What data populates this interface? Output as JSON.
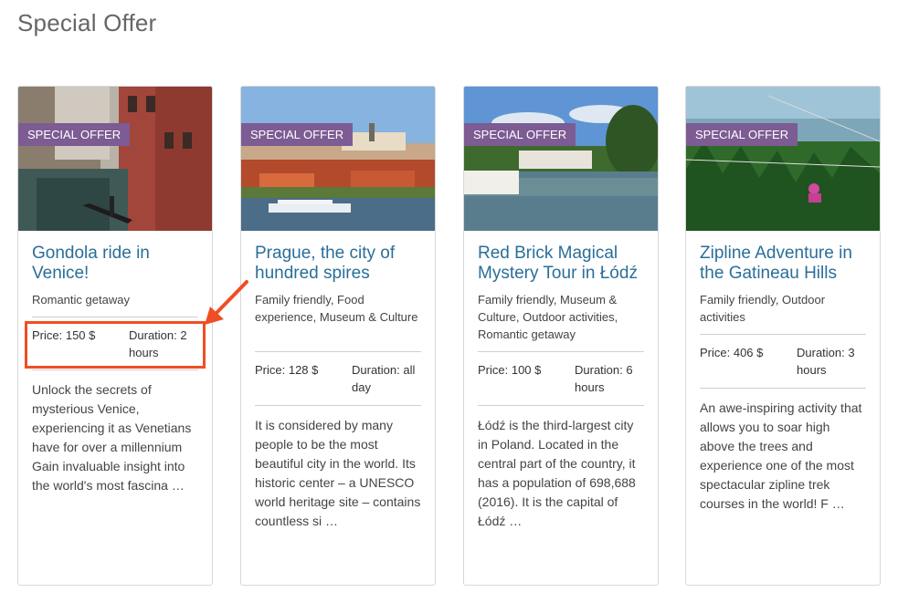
{
  "page": {
    "title": "Special Offer"
  },
  "badge_label": "SPECIAL OFFER",
  "colors": {
    "badge": "#7d5b93",
    "title_link": "#2a6e99",
    "annotation": "#f04e23"
  },
  "cards": [
    {
      "title": "Gondola ride in Venice!",
      "tags": "Romantic getaway",
      "price": "Price: 150 $",
      "duration": "Duration: 2 hours",
      "description": "Unlock the secrets of mysterious Venice, experiencing it as Venetians have for over a millennium Gain invaluable insight into the world's most fascina …"
    },
    {
      "title": "Prague, the city of hundred spires",
      "tags": "Family friendly, Food experience, Museum & Culture",
      "price": "Price: 128 $",
      "duration": "Duration: all day",
      "description": "It is considered by many people to be the most beautiful city in the world. Its historic center – a UNESCO world heritage site – contains countless si …"
    },
    {
      "title": "Red Brick Magical Mystery Tour in Łódź",
      "tags": "Family friendly, Museum & Culture, Outdoor activities, Romantic getaway",
      "price": "Price: 100 $",
      "duration": "Duration: 6 hours",
      "description": "Łódź is the third-largest city in Poland. Located in the central part of the country, it has a population of 698,688 (2016). It is the capital of Łódź …"
    },
    {
      "title": "Zipline Adventure in the Gatineau Hills",
      "tags": "Family friendly, Outdoor activities",
      "price": "Price: 406 $",
      "duration": "Duration: 3 hours",
      "description": "An awe-inspiring activity that allows you to soar high above the trees and experience one of the most spectacular zipline trek courses in the world! F …"
    }
  ]
}
